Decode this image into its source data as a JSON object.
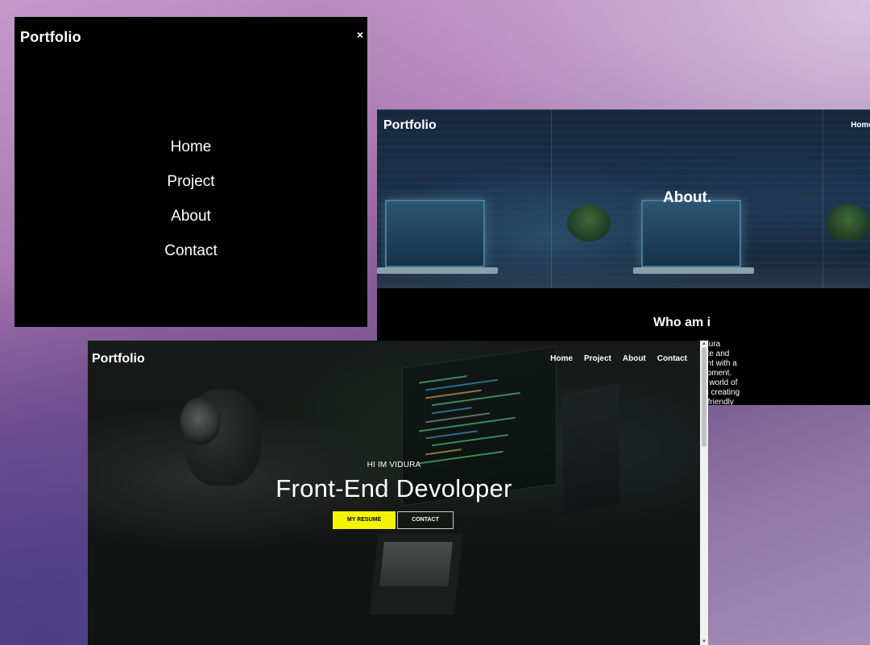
{
  "menu_window": {
    "brand": "Portfolio",
    "close_icon": "×",
    "items": [
      "Home",
      "Project",
      "About",
      "Contact"
    ]
  },
  "about_window": {
    "brand": "Portfolio",
    "nav_peek": "Home",
    "hero_title": "About.",
    "section_title": "Who am i",
    "bio_fragment": "idura\nate and\nent with a\nopment.\ne world of\nin creating\nr-friendly"
  },
  "home_window": {
    "brand": "Portfolio",
    "nav": [
      "Home",
      "Project",
      "About",
      "Contact"
    ],
    "kicker": "HI IM VIDURA",
    "headline": "Front-End Devoloper",
    "resume_button": "MY RESUME",
    "contact_button": "CONTACT"
  },
  "colors": {
    "resume_button": "#f5f500",
    "window_bg": "#000000"
  }
}
